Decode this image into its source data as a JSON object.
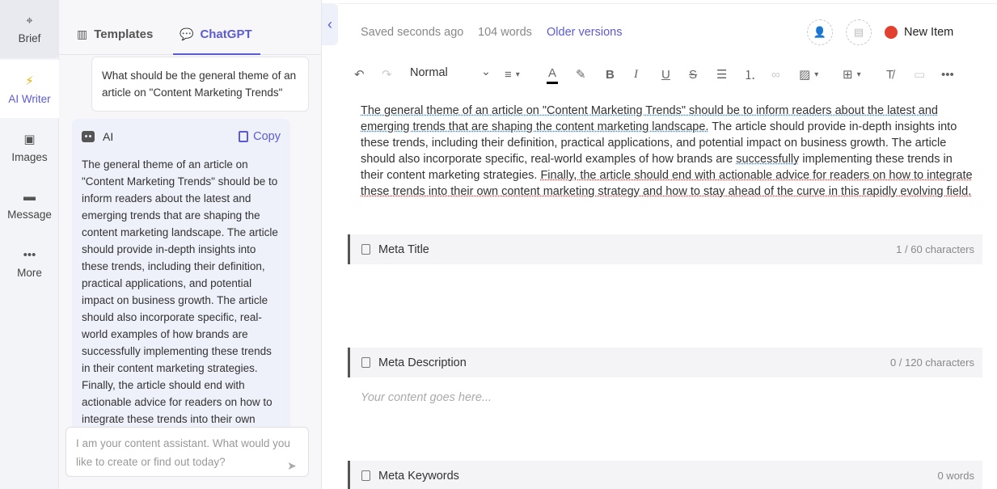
{
  "rail": {
    "items": [
      {
        "label": "Brief",
        "icon": "target-icon"
      },
      {
        "label": "AI Writer",
        "icon": "lightning-icon"
      },
      {
        "label": "Images",
        "icon": "image-icon"
      },
      {
        "label": "Message",
        "icon": "message-icon"
      },
      {
        "label": "More",
        "icon": "more-icon"
      }
    ]
  },
  "panel": {
    "tabs": [
      {
        "label": "Templates",
        "icon": "templates-icon"
      },
      {
        "label": "ChatGPT",
        "icon": "chat-icon"
      }
    ],
    "user_message": "What should be the general theme of an article on \"Content Marketing Trends\"",
    "ai_name": "AI",
    "copy_label": "Copy",
    "ai_response": "The general theme of an article on \"Content Marketing Trends\" should be to inform readers about the latest and emerging trends that are shaping the content marketing landscape. The article should provide in-depth insights into these trends, including their definition, practical applications, and potential impact on business growth. The article should also incorporate specific, real-world examples of how brands are successfully implementing these trends in their content marketing strategies. Finally, the article should end with actionable advice for readers on how to integrate these trends into their own content marketing strategy and how to stay ahead of the curve in this rapidly evolving field.",
    "composer_placeholder": "I am your content assistant. What would you like to create or find out today?"
  },
  "topbar": {
    "saved": "Saved seconds ago",
    "words": "104 words",
    "older_versions": "Older versions",
    "status_label": "New Item",
    "status_color": "#e2412f"
  },
  "toolbar": {
    "style": "Normal"
  },
  "editor": {
    "seg1": "The general theme of an article on \"Content Marketing Trends\" should be to inform readers about the latest and emerging trends that are shaping the content marketing landscape.",
    "seg2": " The article should provide in-depth insights into these trends, including their definition, practical applications, and potential impact on business growth. The article should also incorporate specific, real-world examples of how brands are ",
    "seg3": "successfully",
    "seg4": " implementing these trends in their content marketing strategies. ",
    "seg5": "Finally, the article should end with actionable advice for readers on how to integrate these trends into their own content marketing strategy and how to stay ahead of the curve in this rapidly evolving field."
  },
  "meta": {
    "title_label": "Meta Title",
    "title_count": "1 / 60 characters",
    "desc_label": "Meta Description",
    "desc_count": "0 / 120 characters",
    "desc_placeholder": "Your content goes here...",
    "keywords_label": "Meta Keywords",
    "keywords_count": "0 words"
  },
  "colors": {
    "accent": "#5b5bd6"
  }
}
